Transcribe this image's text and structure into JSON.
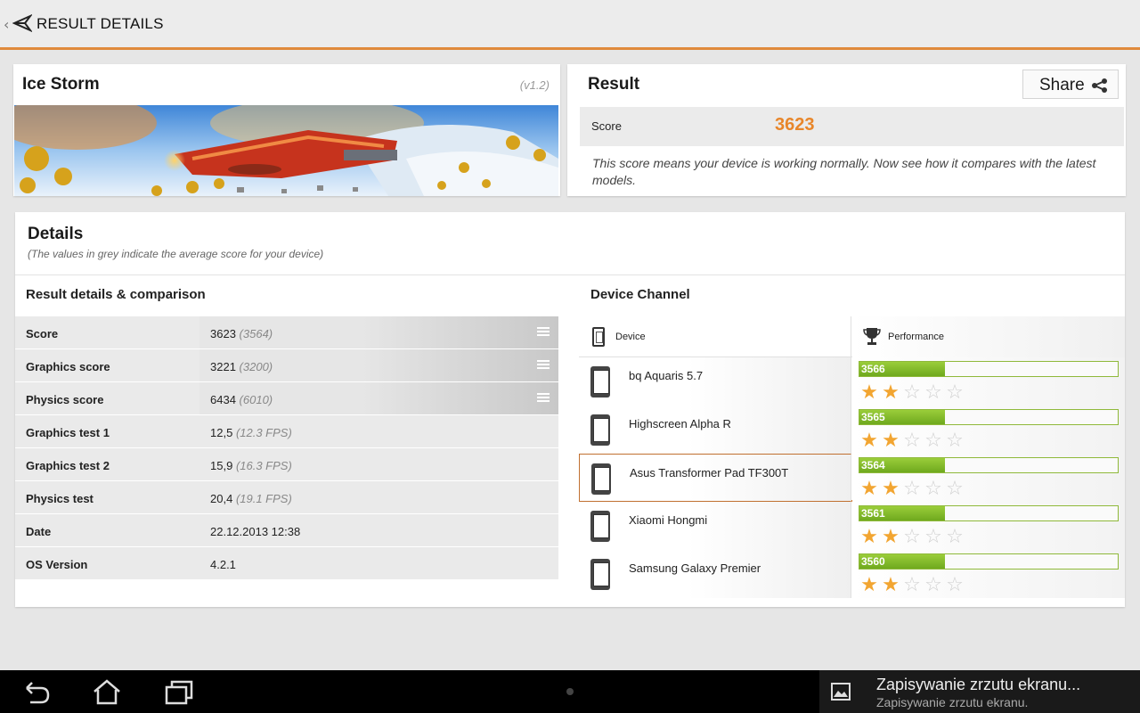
{
  "app": {
    "title": "RESULT DETAILS",
    "up_glyph": "‹"
  },
  "test": {
    "name": "Ice Storm",
    "version": "(v1.2)"
  },
  "result": {
    "title": "Result",
    "share_label": "Share",
    "score_label": "Score",
    "score_value": "3623",
    "description": "This score means your device is working normally. Now see how it compares with the latest models."
  },
  "details": {
    "title": "Details",
    "subtitle": "(The values in grey indicate the average score for your device)",
    "left_title": "Result details & comparison",
    "right_title": "Device Channel",
    "rows": [
      {
        "label": "Score",
        "value": "3623",
        "avg": "(3564)",
        "menu": true
      },
      {
        "label": "Graphics score",
        "value": "3221",
        "avg": "(3200)",
        "menu": true
      },
      {
        "label": "Physics score",
        "value": "6434",
        "avg": "(6010)",
        "menu": true
      },
      {
        "label": "Graphics test 1",
        "value": "12,5",
        "avg": "(12.3 FPS)",
        "menu": false
      },
      {
        "label": "Graphics test 2",
        "value": "15,9",
        "avg": "(16.3 FPS)",
        "menu": false
      },
      {
        "label": "Physics test",
        "value": "20,4",
        "avg": "(19.1 FPS)",
        "menu": false
      },
      {
        "label": "Date",
        "value": "22.12.2013 12:38",
        "avg": "",
        "menu": false
      },
      {
        "label": "OS Version",
        "value": "4.2.1",
        "avg": "",
        "menu": false
      }
    ]
  },
  "device_channel": {
    "col_device": "Device",
    "col_performance": "Performance",
    "devices": [
      {
        "name": "bq Aquaris 5.7",
        "score": "3566",
        "bar_fraction": 0.33,
        "stars": 2,
        "current": false
      },
      {
        "name": "Highscreen Alpha R",
        "score": "3565",
        "bar_fraction": 0.33,
        "stars": 2,
        "current": false
      },
      {
        "name": "Asus Transformer Pad TF300T",
        "score": "3564",
        "bar_fraction": 0.33,
        "stars": 2,
        "current": true
      },
      {
        "name": "Xiaomi Hongmi",
        "score": "3561",
        "bar_fraction": 0.33,
        "stars": 2,
        "current": false
      },
      {
        "name": "Samsung Galaxy Premier",
        "score": "3560",
        "bar_fraction": 0.33,
        "stars": 2,
        "current": false
      }
    ]
  },
  "notification": {
    "title": "Zapisywanie zrzutu ekranu...",
    "subtitle": "Zapisywanie zrzutu ekranu."
  },
  "colors": {
    "accent": "#e08a3c",
    "score": "#e8862a",
    "bar": "#8fc13a",
    "star": "#f2a531"
  }
}
